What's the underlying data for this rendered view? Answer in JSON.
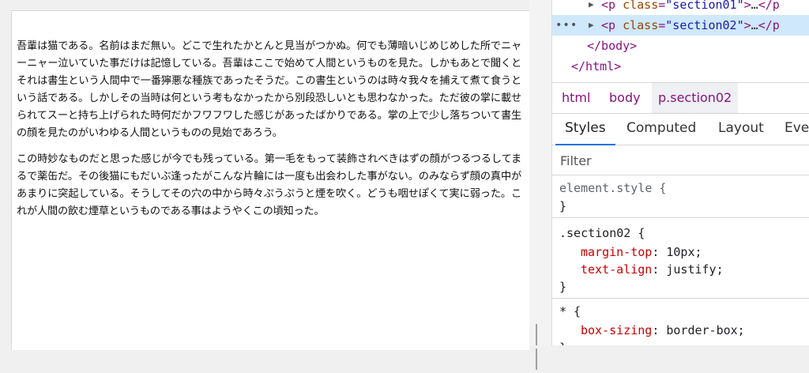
{
  "page": {
    "paragraph1": "吾輩は猫である。名前はまだ無い。どこで生れたかとんと見当がつかぬ。何でも薄暗いじめじめした所でニャーニャー泣いていた事だけは記憶している。吾輩はここで始めて人間というものを見た。しかもあとで聞くとそれは書生という人間中で一番獰悪な種族であったそうだ。この書生というのは時々我々を捕えて煮て食うという話である。しかしその当時は何という考もなかったから別段恐しいとも思わなかった。ただ彼の掌に載せられてスーと持ち上げられた時何だかフワフワした感じがあったばかりである。掌の上で少し落ちついて書生の顔を見たのがいわゆる人間というものの見始であろう。",
    "paragraph2": "この時妙なものだと思った感じが今でも残っている。第一毛をもって装飾されべきはずの顔がつるつるしてまるで薬缶だ。その後猫にもだいぶ逢ったがこんな片輪には一度も出会わした事がない。のみならず顔の真中があまりに突起している。そうしてその穴の中から時々ぷうぷうと煙を吹く。どうも咽せぽくて実に弱った。これが人間の飲む煙草というものである事はようやくこの頃知った。"
  },
  "devtools": {
    "dom": {
      "line1": {
        "open": "<p",
        "attr": "class",
        "eq": "=",
        "value": "\"section01\"",
        "close": ">",
        "ellipsis": "…",
        "end": "</p"
      },
      "line2": {
        "dots": "•••",
        "open": "<p",
        "attr": "class",
        "eq": "=",
        "value": "\"section02\"",
        "close": ">",
        "ellipsis": "…",
        "end": "</p"
      },
      "line3": "</body>",
      "line4": "</html>"
    },
    "breadcrumbs": [
      "html",
      "body",
      "p.section02"
    ],
    "tabs": [
      "Styles",
      "Computed",
      "Layout",
      "Eve"
    ],
    "filter_placeholder": "Filter",
    "rules": {
      "element_style": {
        "selector": "element.style {",
        "close": "}"
      },
      "section02": {
        "selector": ".section02 {",
        "p1_name": "margin-top",
        "p1_value": "10px;",
        "p2_name": "text-align",
        "p2_value": "justify;",
        "close": "}"
      },
      "universal": {
        "selector": "* {",
        "p1_name": "box-sizing",
        "p1_value": "border-box;",
        "close": "}"
      }
    }
  }
}
